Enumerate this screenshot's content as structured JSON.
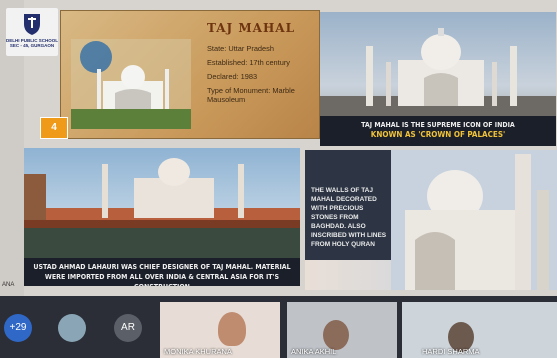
{
  "school": {
    "name": "DELHI PUBLIC SCHOOL",
    "campus": "SEC - 45, GURGAON"
  },
  "slide_number": "4",
  "card1": {
    "title": "TAJ MAHAL",
    "facts": [
      "State: Uttar Pradesh",
      "Established: 17th century",
      "Declared: 1983",
      "Type of Monument: Marble Mausoleum"
    ]
  },
  "card2": {
    "caption": "TAJ MAHAL IS THE SUPREME ICON OF INDIA",
    "highlight": "KNOWN AS 'CROWN OF PALACES'"
  },
  "card3": {
    "caption": "USTAD AHMAD LAHAURI WAS CHIEF DESIGNER OF TAJ MAHAL. MATERIAL WERE IMPORTED FROM ALL OVER INDIA & CENTRAL ASIA FOR IT'S CONSTRUCTION"
  },
  "card4": {
    "caption": "THE WALLS OF TAJ MAHAL DECORATED WITH PRECIOUS STONES FROM BAGHDAD. ALSO INSCRIBED WITH LINES FROM HOLY QURAN"
  },
  "left_label": "ANA",
  "participants": {
    "extra_count": "+29",
    "initials": "AR",
    "names": [
      "MONIKA KHURANA",
      "ANIKA AKHIL",
      "HARDI SHARMA"
    ]
  },
  "colors": {
    "accent": "#f09a1a",
    "caption_bg": "#1b1f29",
    "highlight": "#f0c33a"
  }
}
